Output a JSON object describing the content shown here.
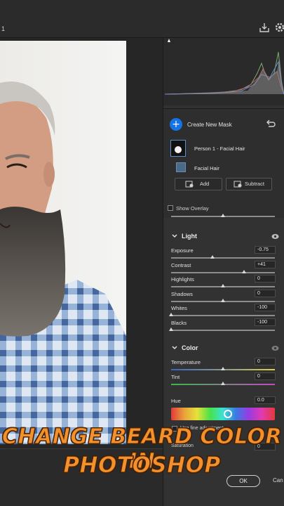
{
  "app": {
    "document_number": "1"
  },
  "masks": {
    "create_label": "Create New Mask",
    "mask_name": "Person 1 - Facial Hair",
    "component_name": "Facial Hair",
    "add_label": "Add",
    "subtract_label": "Subtract",
    "show_overlay_label": "Show Overlay",
    "show_overlay_checked": false
  },
  "light": {
    "title": "Light",
    "adjustments": [
      {
        "label": "Exposure",
        "value": "-0.75",
        "position": 0.4
      },
      {
        "label": "Contrast",
        "value": "+41",
        "position": 0.7
      },
      {
        "label": "Highlights",
        "value": "0",
        "position": 0.5
      },
      {
        "label": "Shadows",
        "value": "0",
        "position": 0.5
      },
      {
        "label": "Whites",
        "value": "-100",
        "position": 0.0
      },
      {
        "label": "Blacks",
        "value": "-100",
        "position": 0.0
      }
    ]
  },
  "color": {
    "title": "Color",
    "adjustments": [
      {
        "label": "Temperature",
        "value": "0",
        "position": 0.5
      },
      {
        "label": "Tint",
        "value": "0",
        "position": 0.5
      }
    ],
    "hue_label": "Hue",
    "hue_value": "0.0",
    "hue_position": 0.55,
    "fine_adjustment_label": "Use fine adjustment",
    "saturation_label": "Saturation",
    "saturation_value": "0"
  },
  "dialog": {
    "ok_label": "OK",
    "cancel_label": "Can"
  },
  "caption": {
    "line1": "Change Beard Color in",
    "line2": "Photoshop"
  },
  "colors": {
    "accent": "#1473e6",
    "caption": "#f3912f",
    "panel": "#323232"
  }
}
